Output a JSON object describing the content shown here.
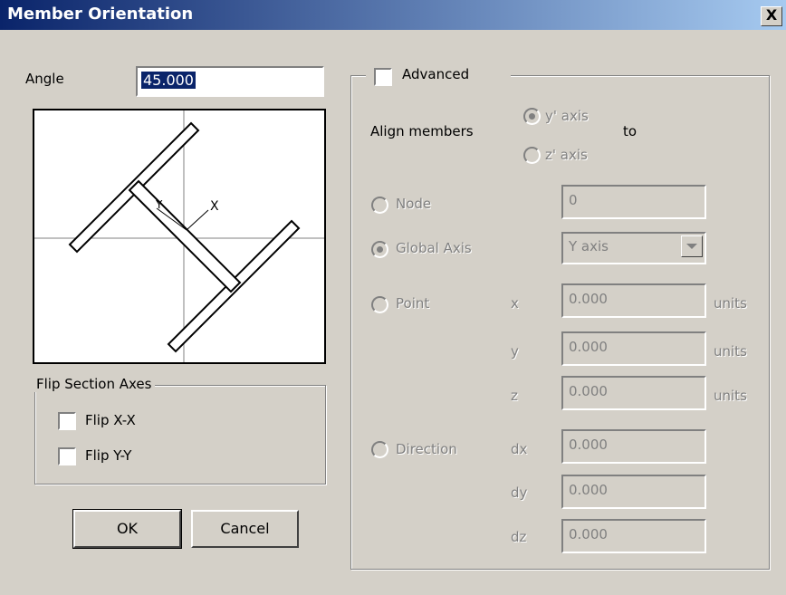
{
  "window": {
    "title": "Member Orientation",
    "close_glyph": "X"
  },
  "angle": {
    "label": "Angle",
    "value": "45.000"
  },
  "preview": {
    "axis_label_x": "X",
    "axis_label_y": "Y"
  },
  "flip": {
    "title": "Flip Section Axes",
    "flip_xx": {
      "label": "Flip X-X",
      "checked": false
    },
    "flip_yy": {
      "label": "Flip Y-Y",
      "checked": false
    }
  },
  "buttons": {
    "ok": "OK",
    "cancel": "Cancel"
  },
  "advanced": {
    "label": "Advanced",
    "checked": false,
    "align_label": "Align members",
    "align_y": "y' axis",
    "align_z": "z' axis",
    "align_to": "to",
    "node": {
      "label": "Node",
      "value": "0"
    },
    "global_axis": {
      "label": "Global Axis",
      "value": "Y axis"
    },
    "point": {
      "label": "Point",
      "x_label": "x",
      "x_value": "0.000",
      "y_label": "y",
      "y_value": "0.000",
      "z_label": "z",
      "z_value": "0.000",
      "units": "units"
    },
    "direction": {
      "label": "Direction",
      "dx_label": "dx",
      "dx_value": "0.000",
      "dy_label": "dy",
      "dy_value": "0.000",
      "dz_label": "dz",
      "dz_value": "0.000"
    }
  }
}
